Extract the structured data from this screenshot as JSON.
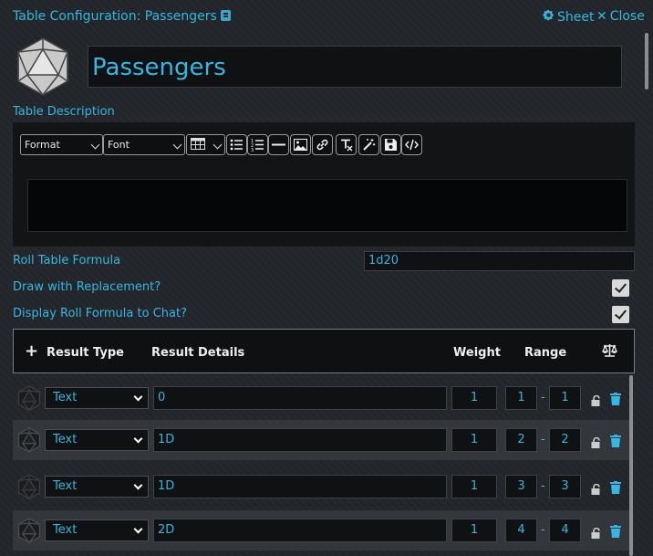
{
  "window": {
    "title": "Table Configuration: Passengers",
    "sheet_label": "Sheet",
    "close_label": "Close"
  },
  "table": {
    "name": "Passengers",
    "description_label": "Table Description",
    "description_value": "",
    "formula_label": "Roll Table Formula",
    "formula_value": "1d20",
    "replacement_label": "Draw with Replacement?",
    "replacement_checked": true,
    "display_formula_label": "Display Roll Formula to Chat?",
    "display_formula_checked": true
  },
  "editor_toolbar": {
    "format_label": "Format",
    "font_label": "Font"
  },
  "results": {
    "headers": {
      "type": "Result Type",
      "details": "Result Details",
      "weight": "Weight",
      "range": "Range"
    },
    "rows": [
      {
        "type": "Text",
        "details": "0",
        "weight": "1",
        "range_low": "1",
        "range_high": "1"
      },
      {
        "type": "Text",
        "details": "1D",
        "weight": "1",
        "range_low": "2",
        "range_high": "2"
      },
      {
        "type": "Text",
        "details": "1D",
        "weight": "1",
        "range_low": "3",
        "range_high": "3"
      },
      {
        "type": "Text",
        "details": "2D",
        "weight": "1",
        "range_low": "4",
        "range_high": "4"
      }
    ]
  },
  "colors": {
    "accent": "#34b7e2",
    "background": "#22262b",
    "field": "#0f1113"
  }
}
